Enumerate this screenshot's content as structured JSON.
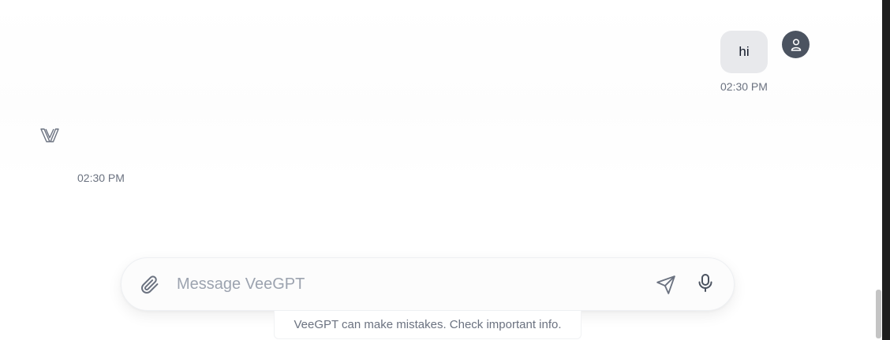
{
  "conversation": {
    "user_message": {
      "text": "hi",
      "time": "02:30 PM",
      "avatar_icon": "user-icon"
    },
    "assistant_message": {
      "logo_icon": "veegpt-logo-icon",
      "time": "02:30 PM"
    }
  },
  "composer": {
    "placeholder": "Message VeeGPT",
    "value": "",
    "attach_icon": "paperclip-icon",
    "send_icon": "send-icon",
    "mic_icon": "microphone-icon"
  },
  "footer": {
    "disclaimer": "VeeGPT can make mistakes. Check important info."
  },
  "colors": {
    "user_bubble": "#e8e9ec",
    "avatar": "#4b5360",
    "muted_text": "#6b7280",
    "placeholder": "#9ca3af"
  }
}
